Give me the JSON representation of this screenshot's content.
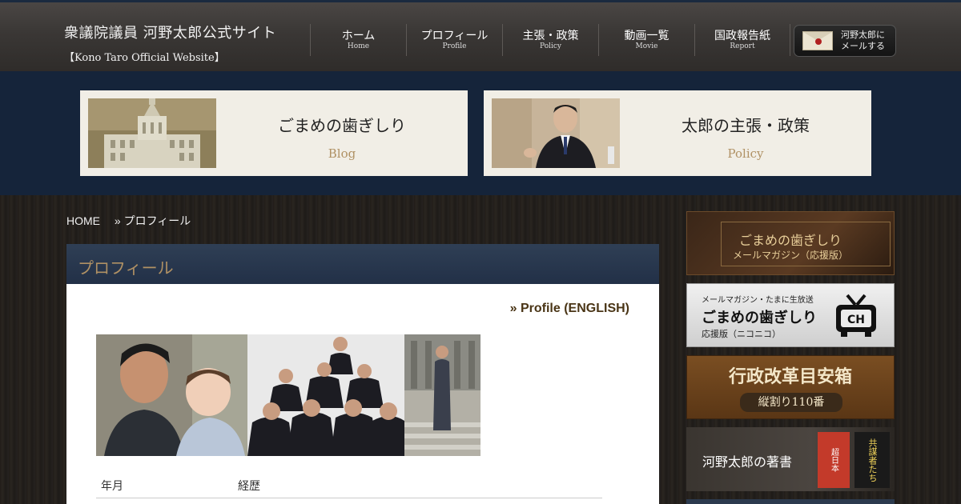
{
  "header": {
    "site_title": "衆議院議員 河野太郎公式サイト",
    "site_subtitle": "【Kono Taro Official Website】",
    "nav": [
      {
        "jp": "ホーム",
        "en": "Home"
      },
      {
        "jp": "プロフィール",
        "en": "Profile"
      },
      {
        "jp": "主張・政策",
        "en": "Policy"
      },
      {
        "jp": "動画一覧",
        "en": "Movie"
      },
      {
        "jp": "国政報告紙",
        "en": "Report"
      }
    ],
    "mail_button": {
      "line1": "河野太郎に",
      "line2": "メールする",
      "icon": "envelope-icon"
    }
  },
  "features": {
    "blog": {
      "title": "ごまめの歯ぎしり",
      "subtitle": "Blog"
    },
    "policy": {
      "title": "太郎の主張・政策",
      "subtitle": "Policy"
    }
  },
  "breadcrumb": {
    "home": "HOME",
    "current": "» プロフィール"
  },
  "main": {
    "title": "プロフィール",
    "english_link": "» Profile (ENGLISH)",
    "table_headers": {
      "col1": "年月",
      "col2": "経歴"
    }
  },
  "sidebar": {
    "banner1": {
      "line1": "ごまめの歯ぎしり",
      "line2": "メールマガジン（応援版）"
    },
    "banner2": {
      "line1": "メールマガジン・たまに生放送",
      "line2": "ごまめの歯ぎしり",
      "line3": "応援版（ニコニコ）",
      "icon_text": "CH"
    },
    "banner3": {
      "line1": "行政改革目安箱",
      "line2": "縦割り110番"
    },
    "banner4": {
      "line1": "河野太郎の著書",
      "book1": "超日本",
      "book2": "共謀者たち"
    }
  },
  "colors": {
    "accent_gold": "#b09164",
    "navy": "#15243a"
  }
}
